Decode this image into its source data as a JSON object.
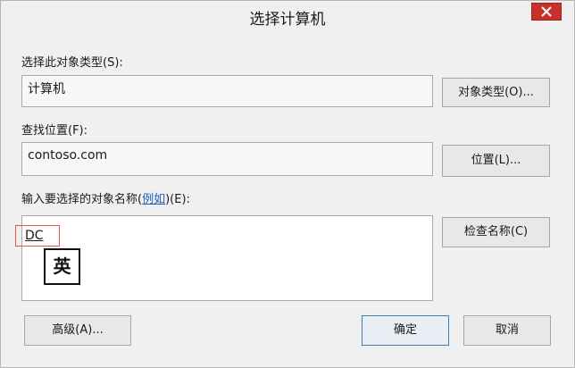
{
  "window": {
    "title": "选择计算机"
  },
  "object_type": {
    "label": "选择此对象类型(S):",
    "value": "计算机",
    "button": "对象类型(O)..."
  },
  "location": {
    "label": "查找位置(F):",
    "value": "contoso.com",
    "button": "位置(L)..."
  },
  "names": {
    "label_prefix": "输入要选择的对象名称(",
    "label_link": "例如",
    "label_suffix": ")(E):",
    "entry_text": "DC",
    "check_button": "检查名称(C)"
  },
  "ime_indicator": "英",
  "footer": {
    "advanced": "高级(A)...",
    "ok": "确定",
    "cancel": "取消"
  },
  "colors": {
    "close_button": "#c7312a",
    "highlight_box": "#e8514f",
    "link": "#1a5fb4"
  }
}
